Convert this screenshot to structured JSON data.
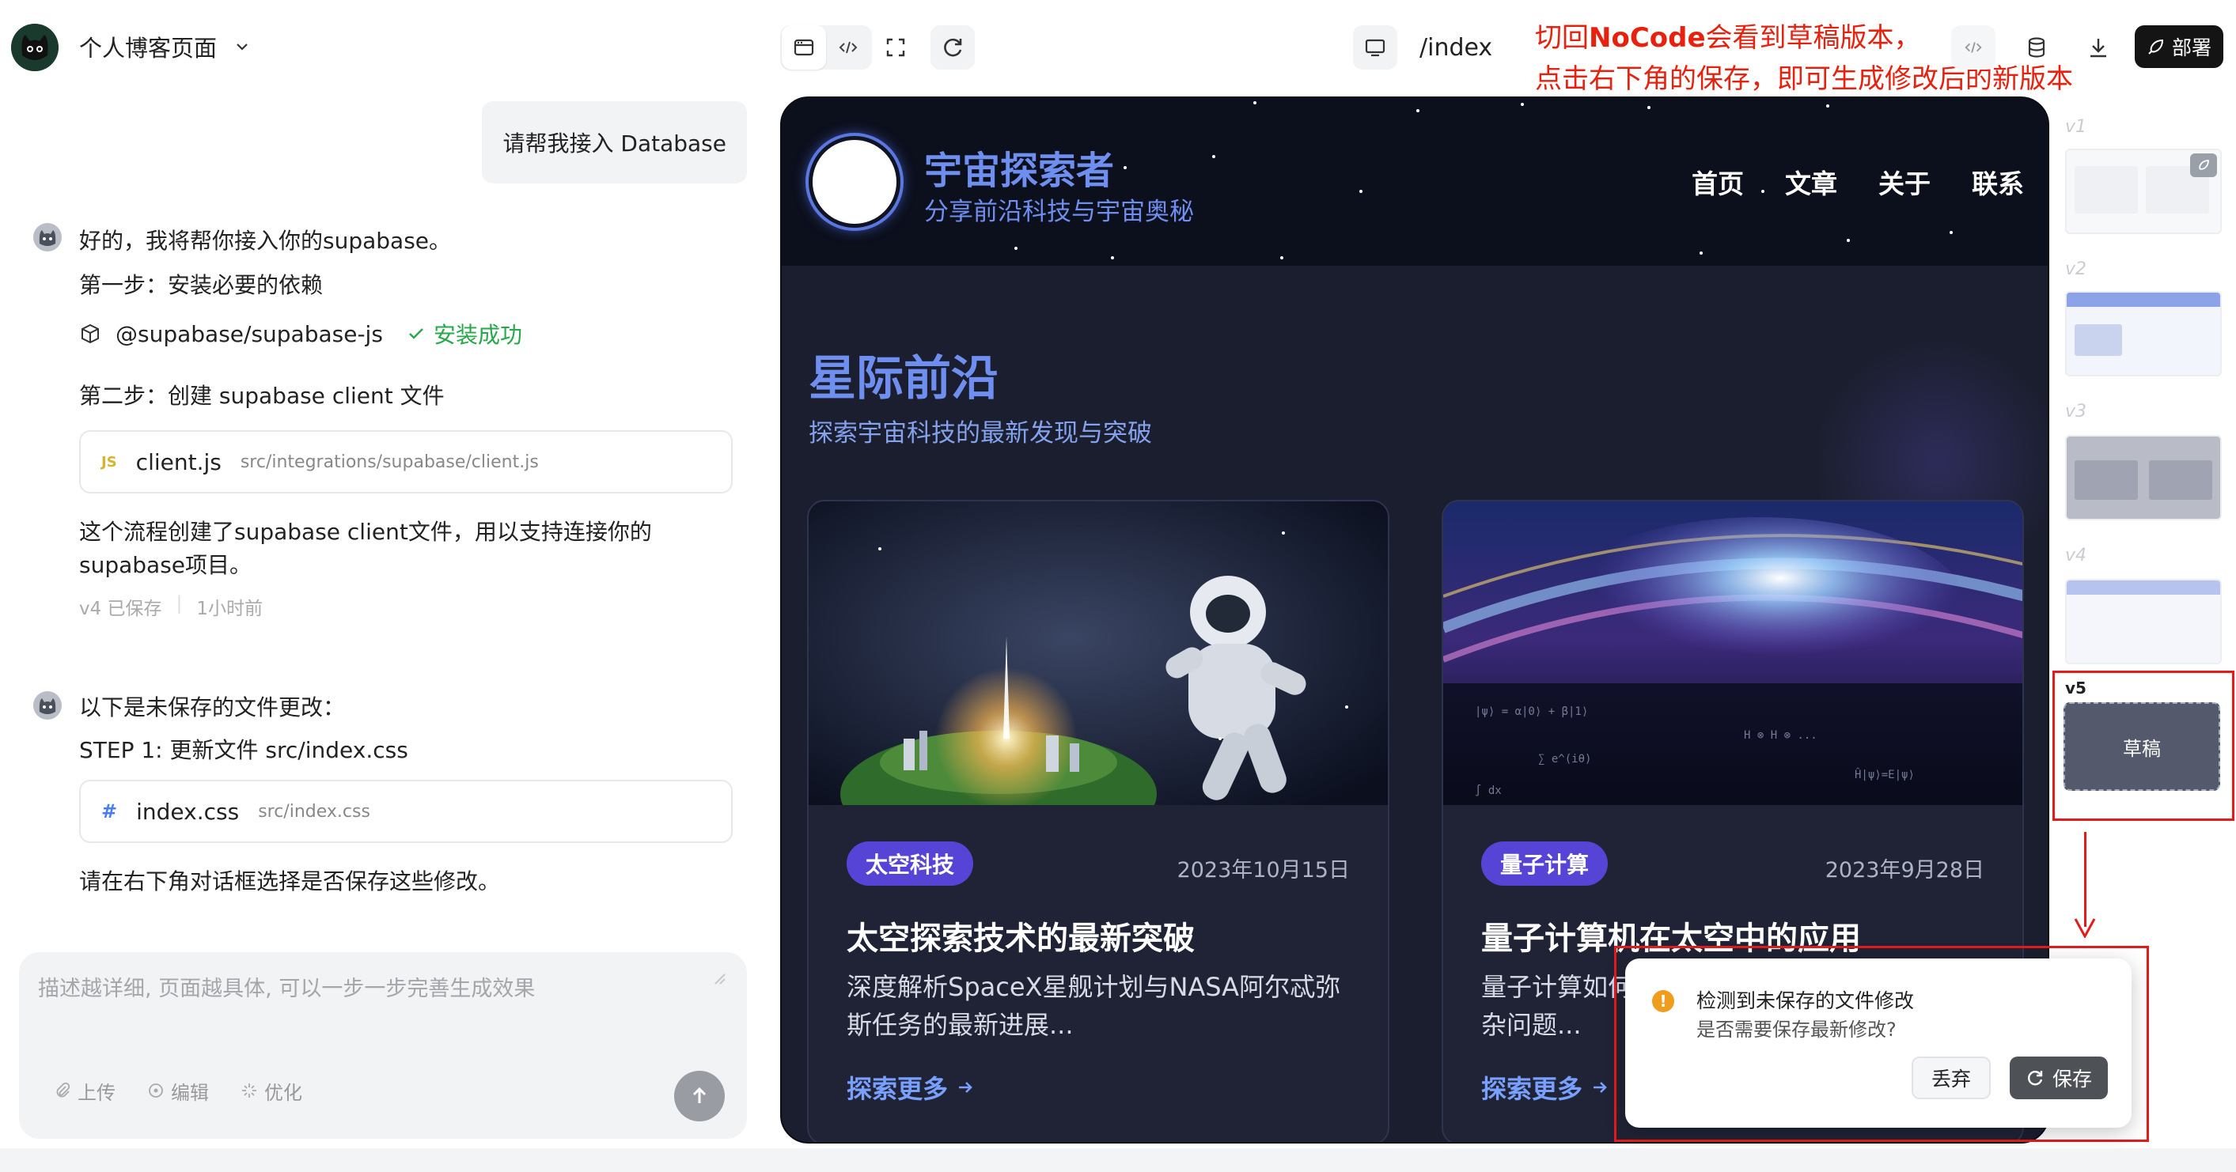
{
  "project": {
    "name": "个人博客页面"
  },
  "toolbar": {
    "route": "/index",
    "deploy_label": "部署"
  },
  "annotation": {
    "line1_prefix": "切回",
    "line1_bold": "NoCode",
    "line1_suffix": "会看到草稿版本，",
    "line2": "点击右下角的保存，即可生成修改后的新版本"
  },
  "chat": {
    "user_message": "请帮我接入 Database",
    "bot1": {
      "intro": "好的，我将帮你接入你的supabase。",
      "step1": "第一步：安装必要的依赖",
      "package_name": "@supabase/supabase-js",
      "package_status": "安装成功",
      "step2": "第二步：创建 supabase client 文件",
      "file": {
        "badge": "JS",
        "name": "client.js",
        "path": "src/integrations/supabase/client.js"
      },
      "summary_line1": "这个流程创建了supabase client文件，用以支持连接你的",
      "summary_line2": "supabase项目。",
      "version_meta": "v4 已保存",
      "time_meta": "1小时前"
    },
    "bot2": {
      "intro": "以下是未保存的文件更改：",
      "step": "STEP 1: 更新文件 src/index.css",
      "file": {
        "badge": "#",
        "name": "index.css",
        "path": "src/index.css"
      },
      "outro": "请在右下角对话框选择是否保存这些修改。"
    },
    "input": {
      "placeholder": "描述越详细, 页面越具体, 可以一步一步完善生成效果",
      "upload": "上传",
      "edit": "编辑",
      "optimize": "优化"
    }
  },
  "preview": {
    "site_title": "宇宙探索者",
    "site_subtitle": "分享前沿科技与宇宙奥秘",
    "nav": [
      "首页",
      "文章",
      "关于",
      "联系"
    ],
    "hero_title": "星际前沿",
    "hero_subtitle": "探索宇宙科技的最新发现与突破",
    "cards": [
      {
        "tag": "太空科技",
        "date": "2023年10月15日",
        "title": "太空探索技术的最新突破",
        "desc_line1": "深度解析SpaceX星舰计划与NASA阿尔忒弥",
        "desc_line2": "斯任务的最新进展...",
        "more": "探索更多"
      },
      {
        "tag": "量子计算",
        "date": "2023年9月28日",
        "title": "量子计算机在太空中的应用",
        "desc_line1": "量子计算如何",
        "desc_line2": "杂问题...",
        "more": "探索更多"
      }
    ]
  },
  "dialog": {
    "title": "检测到未保存的文件修改",
    "subtitle": "是否需要保存最新修改?",
    "discard": "丢弃",
    "save": "保存"
  },
  "versions": [
    {
      "label": "v1"
    },
    {
      "label": "v2"
    },
    {
      "label": "v3"
    },
    {
      "label": "v4"
    },
    {
      "label": "v5",
      "draft": "草稿"
    }
  ],
  "colors": {
    "accent": "#6f8ff0",
    "tag": "#5644d6",
    "annotation_red": "#e8200e",
    "success": "#27a84a"
  }
}
